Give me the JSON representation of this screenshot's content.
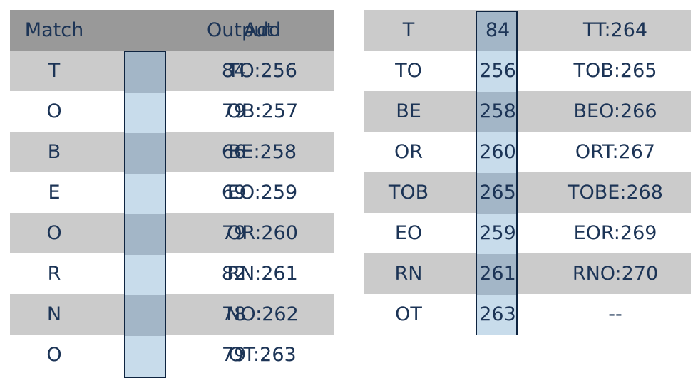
{
  "left_table": {
    "headers": {
      "match": "Match",
      "output": "Output",
      "add": "Add"
    },
    "rows": [
      {
        "match": "T",
        "output": "84",
        "add": "TO:256"
      },
      {
        "match": "O",
        "output": "79",
        "add": "OB:257"
      },
      {
        "match": "B",
        "output": "66",
        "add": "BE:258"
      },
      {
        "match": "E",
        "output": "69",
        "add": "EO:259"
      },
      {
        "match": "O",
        "output": "79",
        "add": "OR:260"
      },
      {
        "match": "R",
        "output": "82",
        "add": "RN:261"
      },
      {
        "match": "N",
        "output": "78",
        "add": "NO:262"
      },
      {
        "match": "O",
        "output": "79",
        "add": "OT:263"
      }
    ]
  },
  "right_table": {
    "rows": [
      {
        "match": "T",
        "output": "84",
        "add": "TT:264"
      },
      {
        "match": "TO",
        "output": "256",
        "add": "TOB:265"
      },
      {
        "match": "BE",
        "output": "258",
        "add": "BEO:266"
      },
      {
        "match": "OR",
        "output": "260",
        "add": "ORT:267"
      },
      {
        "match": "TOB",
        "output": "265",
        "add": "TOBE:268"
      },
      {
        "match": "EO",
        "output": "259",
        "add": "EOR:269"
      },
      {
        "match": "RN",
        "output": "261",
        "add": "RNO:270"
      },
      {
        "match": "OT",
        "output": "263",
        "add": "--"
      }
    ]
  },
  "colors": {
    "text": "#1c3456",
    "header_bg": "#999999",
    "row_gray": "#cbcbcb",
    "output_dark": "#a3b6c7",
    "output_light": "#c8dceb",
    "output_border": "#0e2440"
  }
}
